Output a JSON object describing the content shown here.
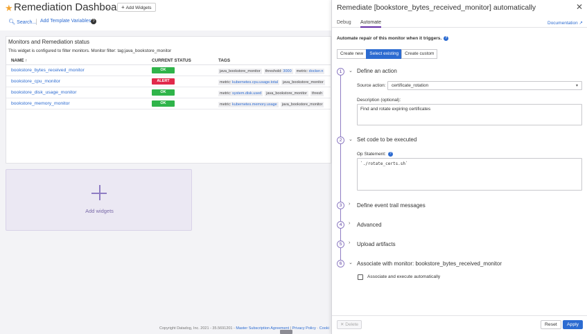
{
  "dashboard": {
    "title": "Remediation Dashboard",
    "add_widgets_label": "Add Widgets",
    "search_label": "Search...",
    "template_vars_label": "Add Template Variables",
    "help_glyph": "?",
    "widget": {
      "title": "Monitors and Remediation status",
      "description": "This widget is configured to filter monitors. Monitor filter: tag:java_bookstore_monitor",
      "columns": [
        "NAME ↑",
        "CURRENT STATUS",
        "TAGS"
      ],
      "rows": [
        {
          "name": "bookstore_bytes_received_monitor",
          "status": "OK",
          "status_color": "#2fb44a",
          "tags": [
            {
              "k": "java_bookstore_monitor",
              "v": ""
            },
            {
              "k": "threshold: ",
              "v": "3000"
            },
            {
              "k": "metric: ",
              "v": "docker.n"
            }
          ]
        },
        {
          "name": "bookstore_cpu_monitor",
          "status": "ALERT",
          "status_color": "#e1294b",
          "tags": [
            {
              "k": "metric: ",
              "v": "kubernetes.cpu.usage.total"
            },
            {
              "k": "java_bookstore_monitor",
              "v": ""
            }
          ]
        },
        {
          "name": "bookstore_disk_usage_monitor",
          "status": "OK",
          "status_color": "#2fb44a",
          "tags": [
            {
              "k": "metric: ",
              "v": "system.disk.used"
            },
            {
              "k": "java_bookstore_monitor",
              "v": ""
            },
            {
              "k": "thresh",
              "v": ""
            }
          ]
        },
        {
          "name": "bookstore_memory_monitor",
          "status": "OK",
          "status_color": "#2fb44a",
          "tags": [
            {
              "k": "metric: ",
              "v": "kubernetes.memory.usage"
            },
            {
              "k": "java_bookstore_monitor",
              "v": ""
            }
          ]
        }
      ]
    },
    "add_widget_card_label": "Add widgets",
    "footer": {
      "copyright": "Copyright Datadog, Inc. 2021 - 35.5691201 - ",
      "msa": "Master Subscription Agreement",
      "privacy": "Privacy Policy",
      "cookie": "Cooki"
    }
  },
  "panel": {
    "title": "Remediate [bookstore_bytes_received_monitor] automatically",
    "close_glyph": "✕",
    "tabs": [
      "Debug",
      "Automate"
    ],
    "documentation_label": "Documentation ↗",
    "automate_header": "Automate repair of this monitor when it triggers.",
    "segments": [
      "Create new",
      "Select existing",
      "Create custom"
    ],
    "steps": [
      {
        "num": "1",
        "title": "Define an action",
        "expanded": true
      },
      {
        "num": "2",
        "title": "Set code to be executed",
        "expanded": true
      },
      {
        "num": "3",
        "title": "Define event trail messages",
        "expanded": false
      },
      {
        "num": "4",
        "title": "Advanced",
        "expanded": false
      },
      {
        "num": "5",
        "title": "Upload artifacts",
        "expanded": false
      },
      {
        "num": "6",
        "title": "Associate with monitor: bookstore_bytes_received_monitor",
        "expanded": true
      }
    ],
    "source_action": {
      "label": "Source action:",
      "value": "certificate_rotation"
    },
    "description": {
      "label": "Description (optional):",
      "value": "Find and rotate expiring certificates"
    },
    "op_statement": {
      "label": "Op Statement:",
      "value": "`./rotate_certs.sh`"
    },
    "associate_checkbox_label": "Associate and execute automatically",
    "delete_label": "✕  Delete",
    "reset_label": "Reset",
    "apply_label": "Apply"
  }
}
